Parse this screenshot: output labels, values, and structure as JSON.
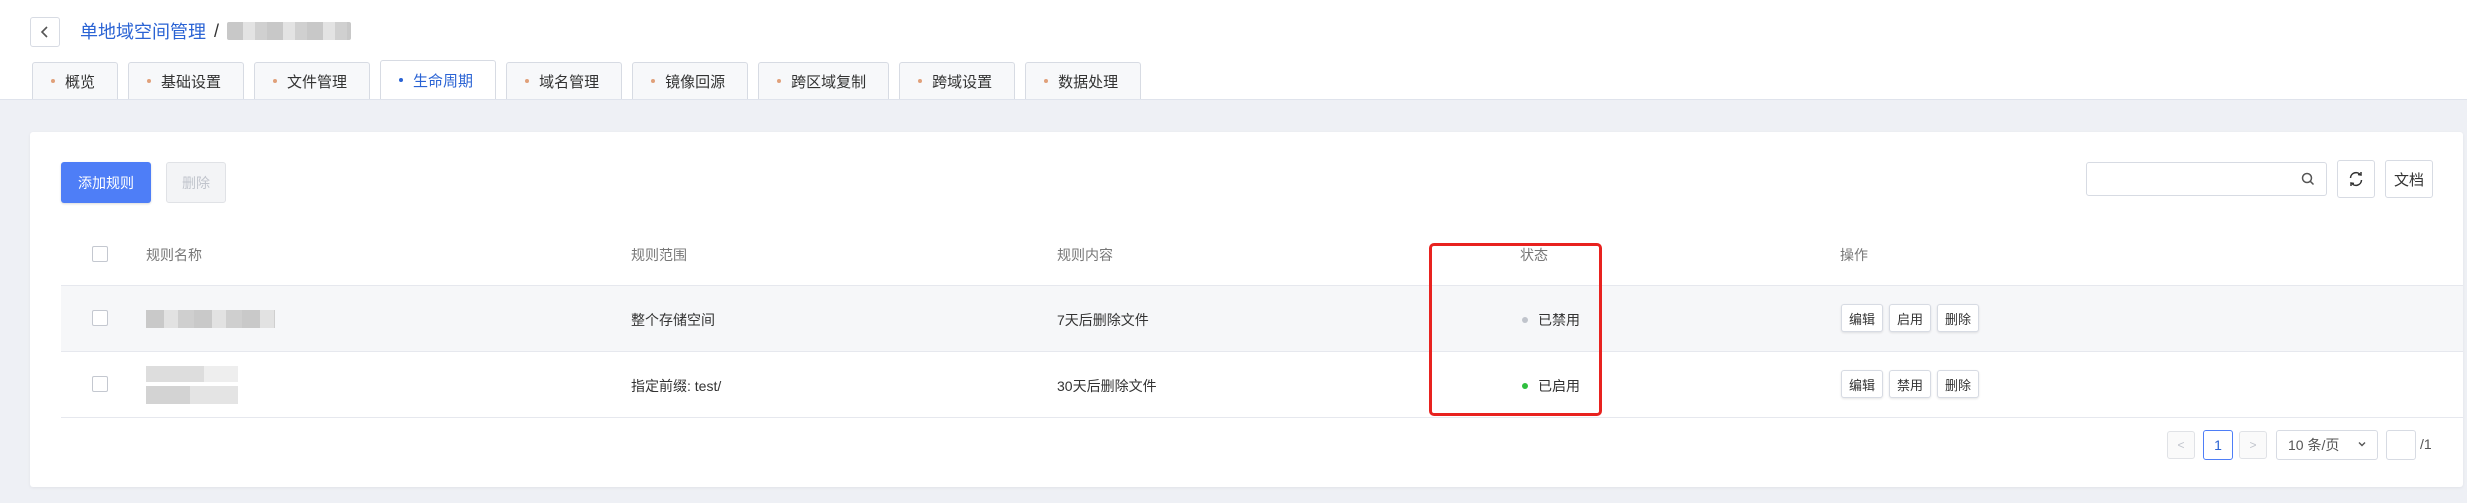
{
  "header": {
    "breadcrumb_link": "单地域空间管理",
    "breadcrumb_sep": "/"
  },
  "tabs": [
    {
      "label": "概览",
      "active": false
    },
    {
      "label": "基础设置",
      "active": false
    },
    {
      "label": "文件管理",
      "active": false
    },
    {
      "label": "生命周期",
      "active": true
    },
    {
      "label": "域名管理",
      "active": false
    },
    {
      "label": "镜像回源",
      "active": false
    },
    {
      "label": "跨区域复制",
      "active": false
    },
    {
      "label": "跨域设置",
      "active": false
    },
    {
      "label": "数据处理",
      "active": false
    }
  ],
  "toolbar": {
    "add_rule": "添加规则",
    "delete": "删除",
    "search_placeholder": "",
    "doc": "文档"
  },
  "table": {
    "columns": [
      "规则名称",
      "规则范围",
      "规则内容",
      "状态",
      "操作"
    ],
    "rows": [
      {
        "name": "",
        "scope": "整个存储空间",
        "content": "7天后删除文件",
        "status": "已禁用",
        "status_color": "#c0c4cc",
        "actions": [
          "编辑",
          "启用",
          "删除"
        ]
      },
      {
        "name": "",
        "scope": "指定前缀: test/",
        "content": "30天后删除文件",
        "status": "已启用",
        "status_color": "#2fbf3f",
        "actions": [
          "编辑",
          "禁用",
          "删除"
        ]
      }
    ]
  },
  "pagination": {
    "prev": "<",
    "current": "1",
    "next": ">",
    "page_size": "10 条/页",
    "total": "/1"
  },
  "colors": {
    "accent": "#4e7ef7",
    "link": "#2a63d4",
    "highlight": "#e8221f"
  }
}
